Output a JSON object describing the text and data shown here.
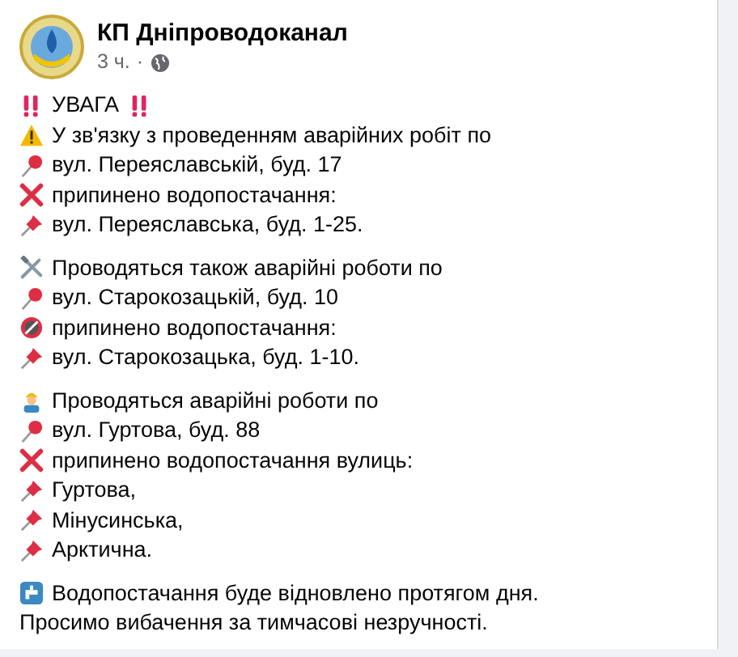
{
  "post": {
    "author": "КП Дніпроводоканал",
    "time": "3 ч.",
    "separator": "·",
    "paragraphs": [
      {
        "lines": [
          {
            "kind": "alert",
            "text": "УВАГА"
          },
          {
            "kind": "warning",
            "text": "У зв'язку з проведенням аварійних робіт по"
          },
          {
            "kind": "location",
            "text": "вул. Переяславській, буд. 17"
          },
          {
            "kind": "stop",
            "text": "припинено водопостачання:"
          },
          {
            "kind": "address",
            "text": "вул. Переяславська, буд. 1-25."
          }
        ]
      },
      {
        "lines": [
          {
            "kind": "repair",
            "text": "Проводяться також аварійні роботи по"
          },
          {
            "kind": "location",
            "text": "вул. Старокозацькій, буд. 10"
          },
          {
            "kind": "prohibited",
            "text": "припинено водопостачання:"
          },
          {
            "kind": "address",
            "text": "вул. Старокозацька, буд. 1-10."
          }
        ]
      },
      {
        "lines": [
          {
            "kind": "crew",
            "text": "Проводяться аварійні роботи по"
          },
          {
            "kind": "location",
            "text": "вул. Гуртова, буд. 88"
          },
          {
            "kind": "stop",
            "text": "припинено водопостачання вулиць:"
          },
          {
            "kind": "address",
            "text": "Гуртова,"
          },
          {
            "kind": "address",
            "text": "Мінусинська,"
          },
          {
            "kind": "address",
            "text": "Арктична."
          }
        ]
      },
      {
        "lines": [
          {
            "kind": "notice",
            "text": "Водопостачання буде відновлено протягом дня."
          },
          {
            "kind": "plain",
            "text": "Просимо вибачення за тимчасові незручності."
          }
        ]
      }
    ]
  }
}
